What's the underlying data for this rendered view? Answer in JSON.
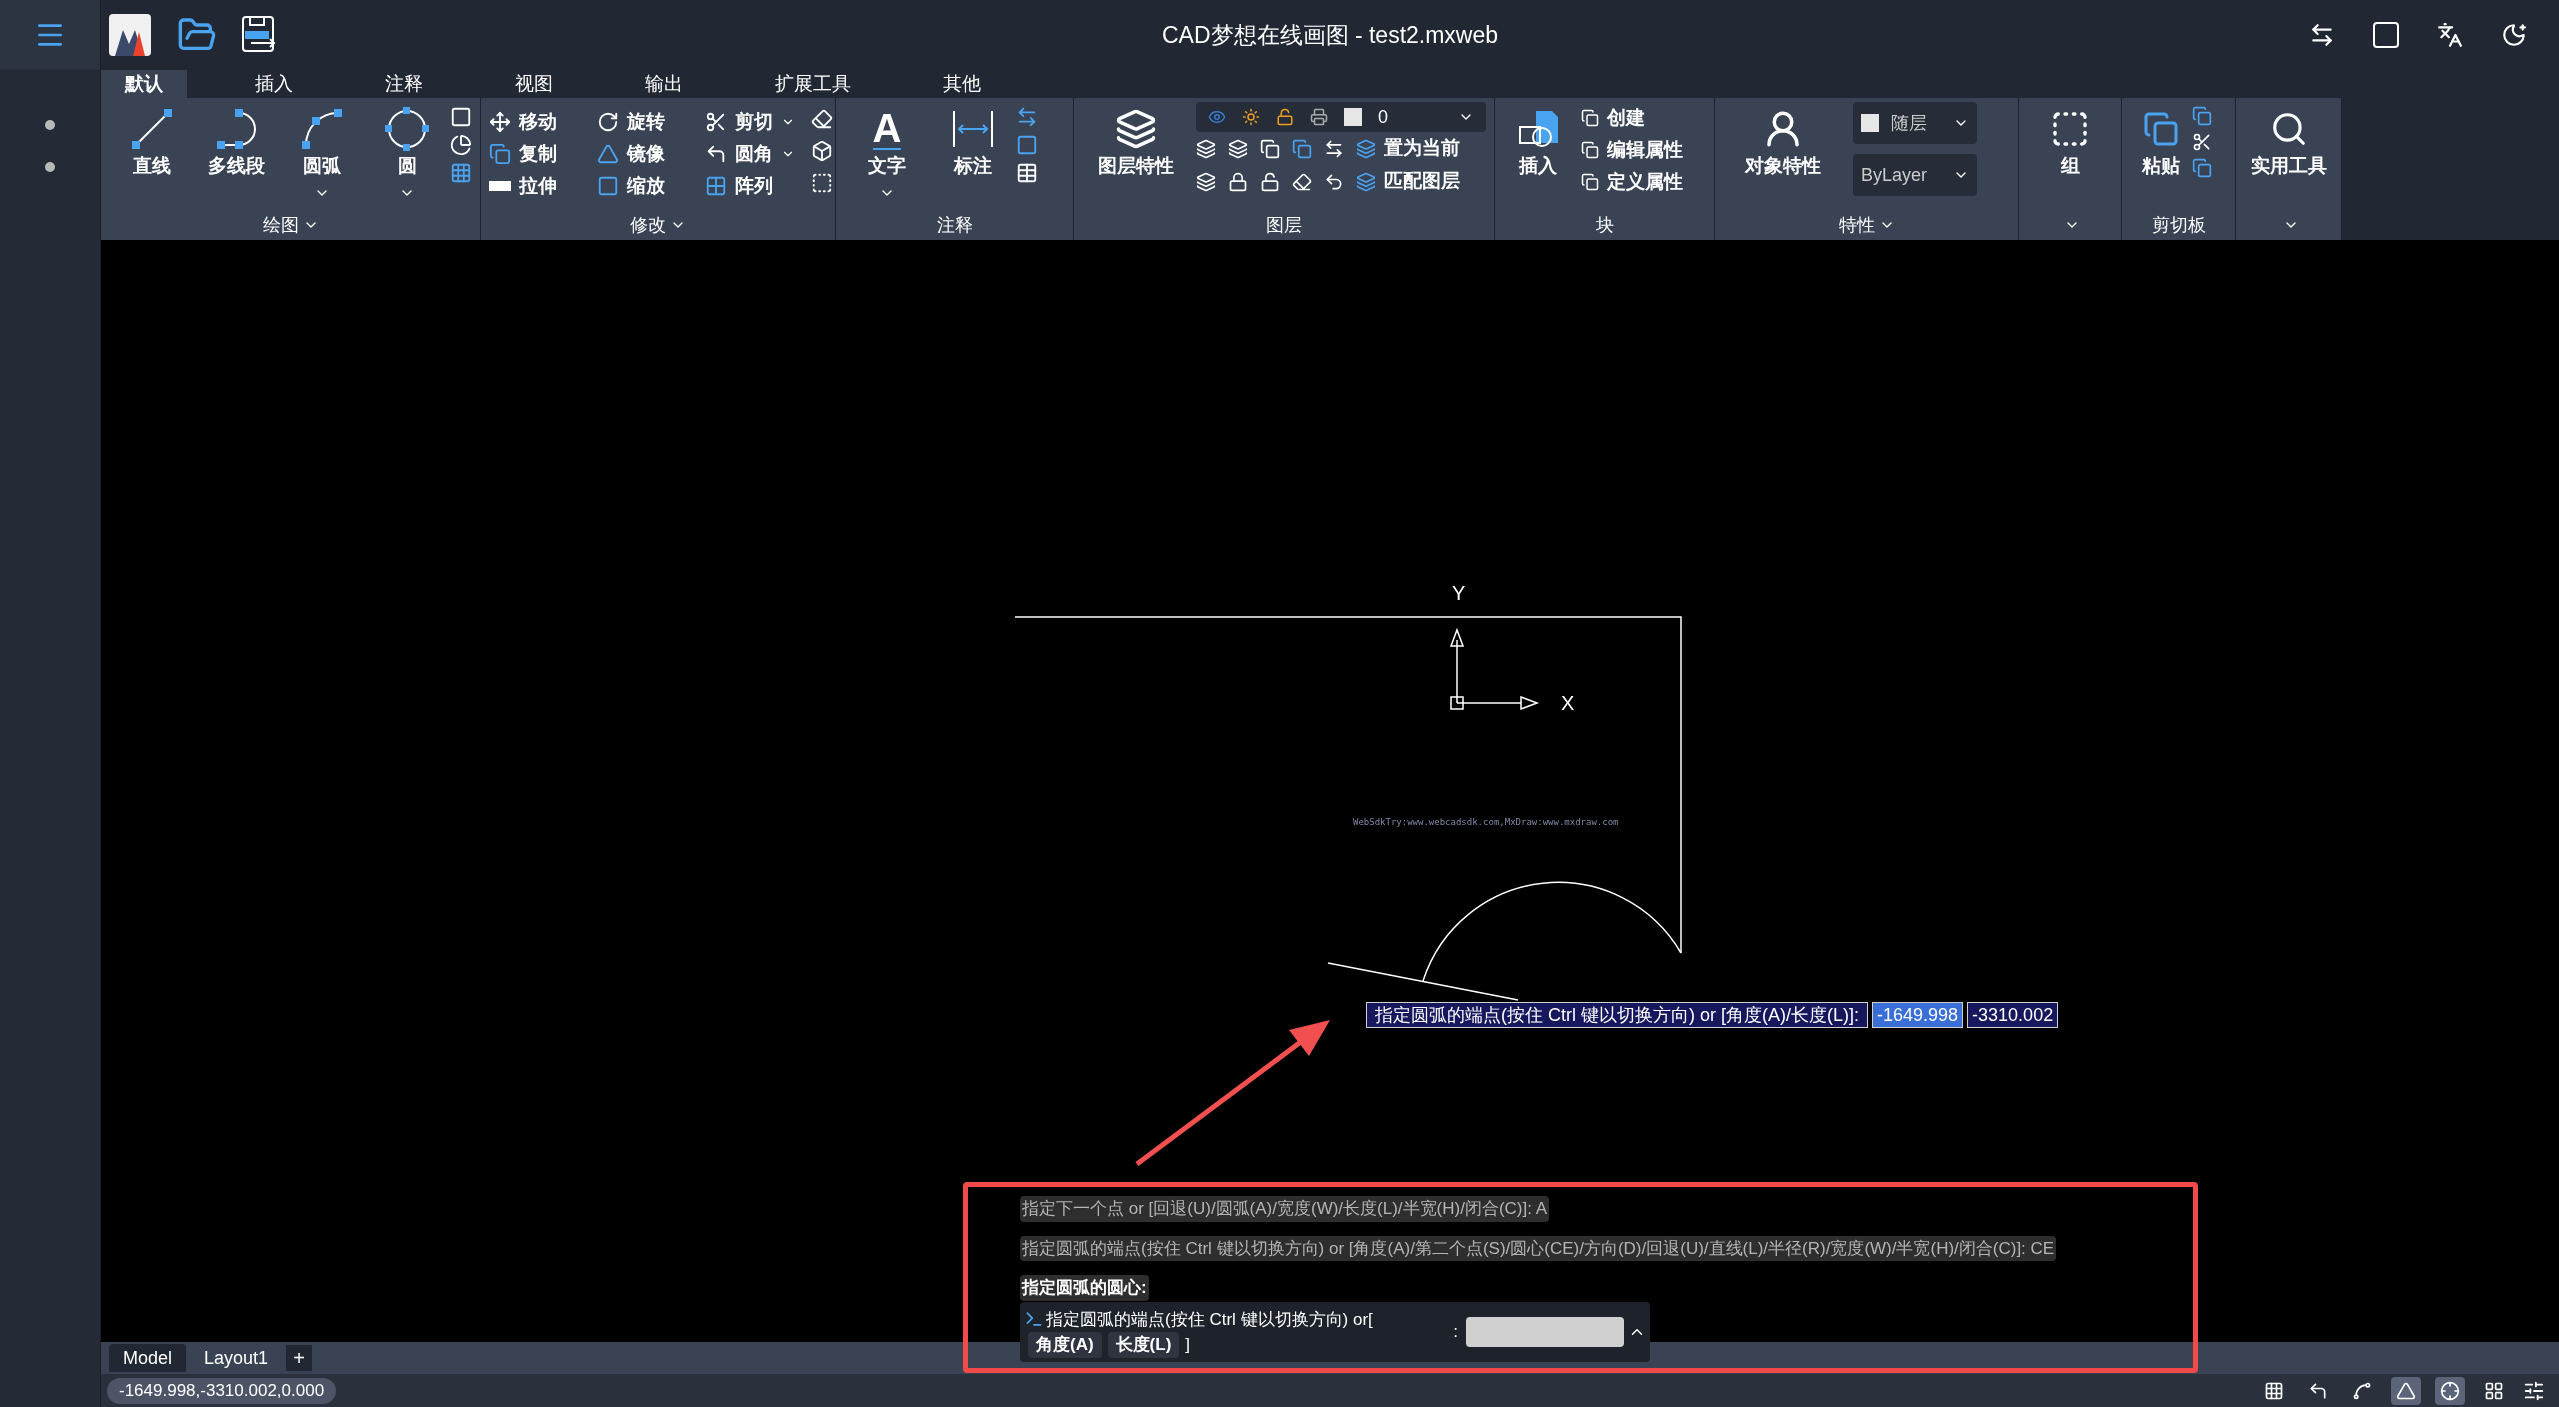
{
  "window": {
    "title": "CAD梦想在线画图 - test2.mxweb"
  },
  "ribbon_tabs": [
    {
      "label": "默认",
      "selected": true
    },
    {
      "label": "插入",
      "selected": false
    },
    {
      "label": "注释",
      "selected": false
    },
    {
      "label": "视图",
      "selected": false
    },
    {
      "label": "输出",
      "selected": false
    },
    {
      "label": "扩展工具",
      "selected": false
    },
    {
      "label": "其他",
      "selected": false
    }
  ],
  "ribbon": {
    "draw": {
      "title": "绘图",
      "large": [
        {
          "label": "直线",
          "caret": false
        },
        {
          "label": "多线段",
          "caret": false
        },
        {
          "label": "圆弧",
          "caret": true
        },
        {
          "label": "圆",
          "caret": true
        }
      ]
    },
    "modify": {
      "title": "修改",
      "tools": [
        {
          "label": "移动",
          "caret": false
        },
        {
          "label": "旋转",
          "caret": false
        },
        {
          "label": "剪切",
          "caret": true
        },
        {
          "label": "复制",
          "caret": false
        },
        {
          "label": "镜像",
          "caret": false
        },
        {
          "label": "圆角",
          "caret": true
        },
        {
          "label": "拉伸",
          "caret": false
        },
        {
          "label": "缩放",
          "caret": false
        },
        {
          "label": "阵列",
          "caret": false
        }
      ]
    },
    "annotate": {
      "title": "注释",
      "large": [
        {
          "label": "文字",
          "caret": true,
          "icon_glyph": "A"
        },
        {
          "label": "标注",
          "caret": false
        }
      ]
    },
    "layers": {
      "title": "图层",
      "large_label": "图层特性",
      "current_layer": "0",
      "tools": [
        "置为当前",
        "匹配图层"
      ]
    },
    "block": {
      "title": "块",
      "large_label": "插入",
      "tools": [
        "创建",
        "编辑属性",
        "定义属性"
      ]
    },
    "properties": {
      "title": "特性",
      "large_label": "对象特性",
      "color_select": "随层",
      "linetype_select": "ByLayer"
    },
    "group": {
      "label": "组"
    },
    "clipboard": {
      "title": "剪切板",
      "large_label": "粘贴"
    },
    "utilities": {
      "label": "实用工具"
    }
  },
  "canvas": {
    "y_label": "Y",
    "x_label": "X",
    "watermark": "WebSdkTry:www.webcadsdk.com,MxDraw:www.mxdraw.com"
  },
  "dynamic_input": {
    "prompt": "指定圆弧的端点(按住 Ctrl 键以切换方向) or [角度(A)/长度(L)]:",
    "inputs": [
      {
        "value": "-1649.998",
        "selected": true
      },
      {
        "value": "-3310.002",
        "selected": false
      }
    ]
  },
  "command_history": [
    {
      "text": "指定下一个点 or [回退(U)/圆弧(A)/宽度(W)/长度(L)/半宽(H)/闭合(C)]: A",
      "kind": "past"
    },
    {
      "text": "指定圆弧的端点(按住 Ctrl 键以切换方向) or [角度(A)/第二个点(S)/圆心(CE)/方向(D)/回退(U)/直线(L)/半径(R)/宽度(W)/半宽(H)/闭合(C)]: CE",
      "kind": "past"
    },
    {
      "text": "指定圆弧的圆心:",
      "kind": "current"
    }
  ],
  "command_prompt": {
    "text": "指定圆弧的端点(按住 Ctrl 键以切换方向) or[",
    "options": [
      "角度(A)",
      "长度(L)"
    ],
    "closing": "]",
    "separator": ":"
  },
  "layout_tabs": [
    {
      "label": "Model",
      "selected": true
    },
    {
      "label": "Layout1",
      "selected": false
    }
  ],
  "add_tab": "+",
  "status_bar": {
    "coordinates": "-1649.998,-3310.002,0.000",
    "toggles": [
      {
        "on": false
      },
      {
        "on": false
      },
      {
        "on": false
      },
      {
        "on": true
      },
      {
        "on": true
      },
      {
        "on": false
      }
    ]
  }
}
